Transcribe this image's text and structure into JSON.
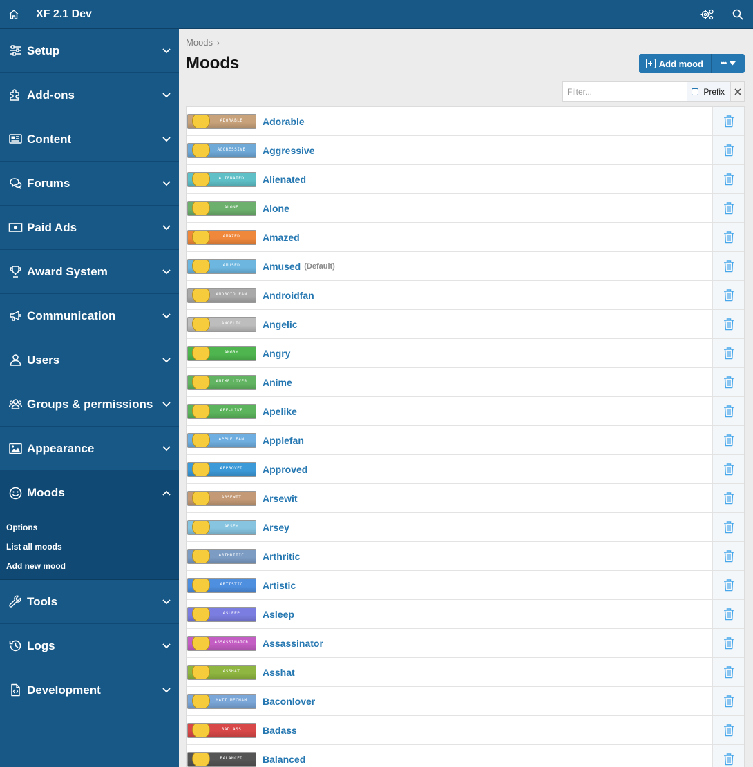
{
  "header": {
    "title": "XF 2.1 Dev",
    "colors": {
      "bar": "#185886",
      "accent": "#2577b1"
    }
  },
  "sidebar": {
    "sections": [
      {
        "label": "Setup",
        "icon": "sliders-icon"
      },
      {
        "label": "Add-ons",
        "icon": "puzzle-icon"
      },
      {
        "label": "Content",
        "icon": "newspaper-icon"
      },
      {
        "label": "Forums",
        "icon": "comments-icon"
      },
      {
        "label": "Paid Ads",
        "icon": "money-bill-icon"
      },
      {
        "label": "Award System",
        "icon": "trophy-icon"
      },
      {
        "label": "Communication",
        "icon": "megaphone-icon"
      },
      {
        "label": "Users",
        "icon": "user-icon"
      },
      {
        "label": "Groups & permissions",
        "icon": "users-icon"
      },
      {
        "label": "Appearance",
        "icon": "image-icon"
      },
      {
        "label": "Moods",
        "icon": "smile-icon",
        "active": true
      },
      {
        "label": "Tools",
        "icon": "wrench-icon"
      },
      {
        "label": "Logs",
        "icon": "history-icon"
      },
      {
        "label": "Development",
        "icon": "code-file-icon"
      }
    ],
    "moods_subnav": [
      "Options",
      "List all moods",
      "Add new mood"
    ]
  },
  "main": {
    "breadcrumb": "Moods",
    "title": "Moods",
    "add_button": "Add mood",
    "more_button": "•••",
    "filter_placeholder": "Filter...",
    "prefix_label": "Prefix",
    "default_label": "(Default)",
    "moods": [
      {
        "name": "Adorable",
        "badge": "ADORABLE",
        "color": "#c8a27a"
      },
      {
        "name": "Aggressive",
        "badge": "AGGRESSIVE",
        "color": "#6fa9d8"
      },
      {
        "name": "Alienated",
        "badge": "ALIENATED",
        "color": "#5fc0c8"
      },
      {
        "name": "Alone",
        "badge": "ALONE",
        "color": "#6db06d"
      },
      {
        "name": "Amazed",
        "badge": "AMAZED",
        "color": "#f0883c"
      },
      {
        "name": "Amused",
        "badge": "AMUSED",
        "color": "#6db6e0",
        "default": true
      },
      {
        "name": "Androidfan",
        "badge": "ANDROID FAN",
        "color": "#a9a9a9"
      },
      {
        "name": "Angelic",
        "badge": "ANGELIC",
        "color": "#bdbdbd"
      },
      {
        "name": "Angry",
        "badge": "ANGRY",
        "color": "#4fb64f"
      },
      {
        "name": "Anime",
        "badge": "ANIME LOVER",
        "color": "#62b462"
      },
      {
        "name": "Apelike",
        "badge": "APE-LIKE",
        "color": "#5cb55c"
      },
      {
        "name": "Applefan",
        "badge": "APPLE FAN",
        "color": "#6faee0"
      },
      {
        "name": "Approved",
        "badge": "APPROVED",
        "color": "#3d9ad8"
      },
      {
        "name": "Arsewit",
        "badge": "ARSEWIT",
        "color": "#c49a76"
      },
      {
        "name": "Arsey",
        "badge": "ARSEY",
        "color": "#86c4e0"
      },
      {
        "name": "Arthritic",
        "badge": "ARTHRITIC",
        "color": "#7c9cc4"
      },
      {
        "name": "Artistic",
        "badge": "ARTISTIC",
        "color": "#4f8fe0"
      },
      {
        "name": "Asleep",
        "badge": "ASLEEP",
        "color": "#7b7ee0"
      },
      {
        "name": "Assassinator",
        "badge": "ASSASSINATOR",
        "color": "#c45ec4"
      },
      {
        "name": "Asshat",
        "badge": "ASSHAT",
        "color": "#8fb640"
      },
      {
        "name": "Baconlover",
        "badge": "MATT MECHAM",
        "color": "#7aa6d8"
      },
      {
        "name": "Badass",
        "badge": "BAD ASS",
        "color": "#d84848"
      },
      {
        "name": "Balanced",
        "badge": "BALANCED",
        "color": "#555555"
      }
    ]
  }
}
